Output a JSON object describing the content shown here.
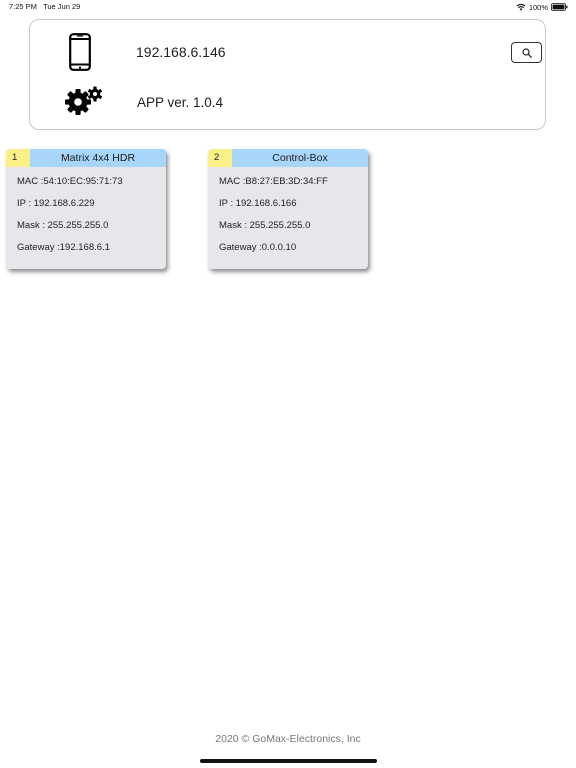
{
  "status_bar": {
    "time": "7:25 PM",
    "date": "Tue Jun 29",
    "battery": "100%",
    "wifi_icon": "wifi-icon",
    "battery_icon": "battery-full-icon"
  },
  "header": {
    "device_icon": "smartphone-icon",
    "ip": "192.168.6.146",
    "settings_icon": "gears-icon",
    "app_version": "APP ver. 1.0.4",
    "search_icon": "search-icon"
  },
  "devices": [
    {
      "index": "1",
      "name": "Matrix 4x4 HDR",
      "mac": "MAC :54:10:EC:95:71:73",
      "ip": "IP : 192.168.6.229",
      "mask": "Mask : 255.255.255.0",
      "gateway": "Gateway :192.168.6.1"
    },
    {
      "index": "2",
      "name": "Control-Box",
      "mac": "MAC :B8:27:EB:3D:34:FF",
      "ip": "IP : 192.168.6.166",
      "mask": "Mask : 255.255.255.0",
      "gateway": "Gateway :0.0.0.10"
    }
  ],
  "colors": {
    "card_header": "#a8d6fb",
    "card_index": "#fbf087",
    "card_body": "#e7e6ea"
  },
  "footer": {
    "copyright": "2020  © GoMax-Electronics, Inc"
  }
}
